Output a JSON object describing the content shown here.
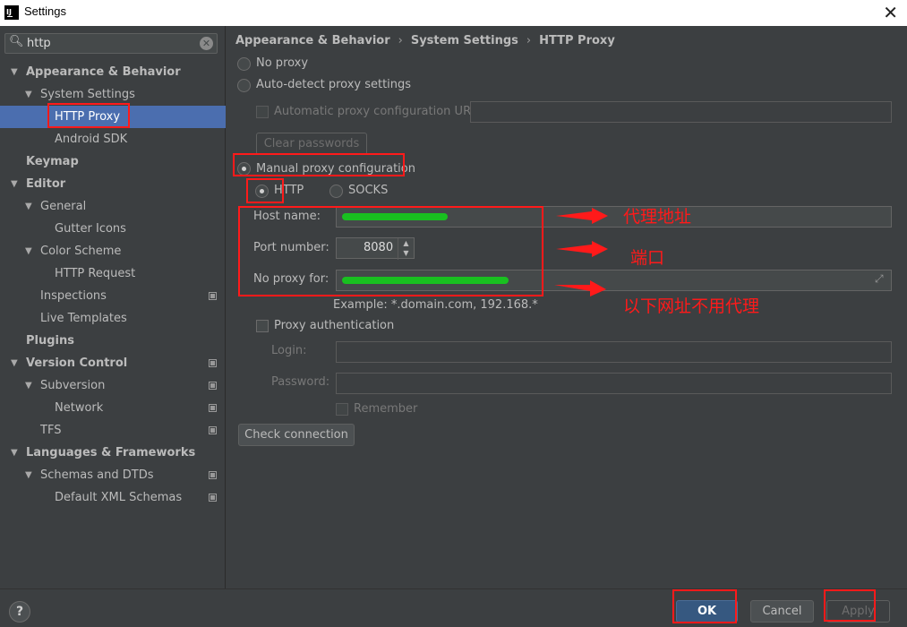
{
  "window": {
    "title": "Settings",
    "close_glyph": "✕",
    "app_icon": "IJ"
  },
  "search": {
    "value": "http",
    "clear_glyph": "✕",
    "search_glyph": "🔍︎"
  },
  "tree": [
    {
      "label": "Appearance & Behavior",
      "arrow": "▼"
    },
    {
      "label": "System Settings",
      "arrow": "▼"
    },
    {
      "label": "HTTP Proxy"
    },
    {
      "label": "Android SDK"
    },
    {
      "label": "Keymap"
    },
    {
      "label": "Editor",
      "arrow": "▼"
    },
    {
      "label": "General",
      "arrow": "▼"
    },
    {
      "label": "Gutter Icons"
    },
    {
      "label": "Color Scheme",
      "arrow": "▼"
    },
    {
      "label": "HTTP Request"
    },
    {
      "label": "Inspections"
    },
    {
      "label": "Live Templates"
    },
    {
      "label": "Plugins"
    },
    {
      "label": "Version Control",
      "arrow": "▼"
    },
    {
      "label": "Subversion",
      "arrow": "▼"
    },
    {
      "label": "Network"
    },
    {
      "label": "TFS"
    },
    {
      "label": "Languages & Frameworks",
      "arrow": "▼"
    },
    {
      "label": "Schemas and DTDs",
      "arrow": "▼"
    },
    {
      "label": "Default XML Schemas"
    }
  ],
  "breadcrumb": {
    "part1": "Appearance & Behavior",
    "part2": "System Settings",
    "part3": "HTTP Proxy",
    "sep": "›"
  },
  "proxy": {
    "no_proxy": "No proxy",
    "auto_detect": "Auto-detect proxy settings",
    "auto_config_url": "Automatic proxy configuration URL:",
    "clear_passwords": "Clear passwords",
    "manual": "Manual proxy configuration",
    "http": "HTTP",
    "socks": "SOCKS",
    "host_label": "Host name:",
    "port_label": "Port number:",
    "port_value": "8080",
    "no_proxy_label": "No proxy for:",
    "example": "Example: *.domain.com, 192.168.*",
    "proxy_auth": "Proxy authentication",
    "login_label": "Login:",
    "password_label": "Password:",
    "remember": "Remember",
    "check_connection": "Check connection",
    "spinner_up": "▲",
    "spinner_down": "▼",
    "expand_glyph": "⤢"
  },
  "annotations": {
    "host": "代理地址",
    "port": "端口",
    "no_proxy": "以下网址不用代理"
  },
  "footer": {
    "help": "?",
    "ok": "OK",
    "cancel": "Cancel",
    "apply": "Apply"
  }
}
